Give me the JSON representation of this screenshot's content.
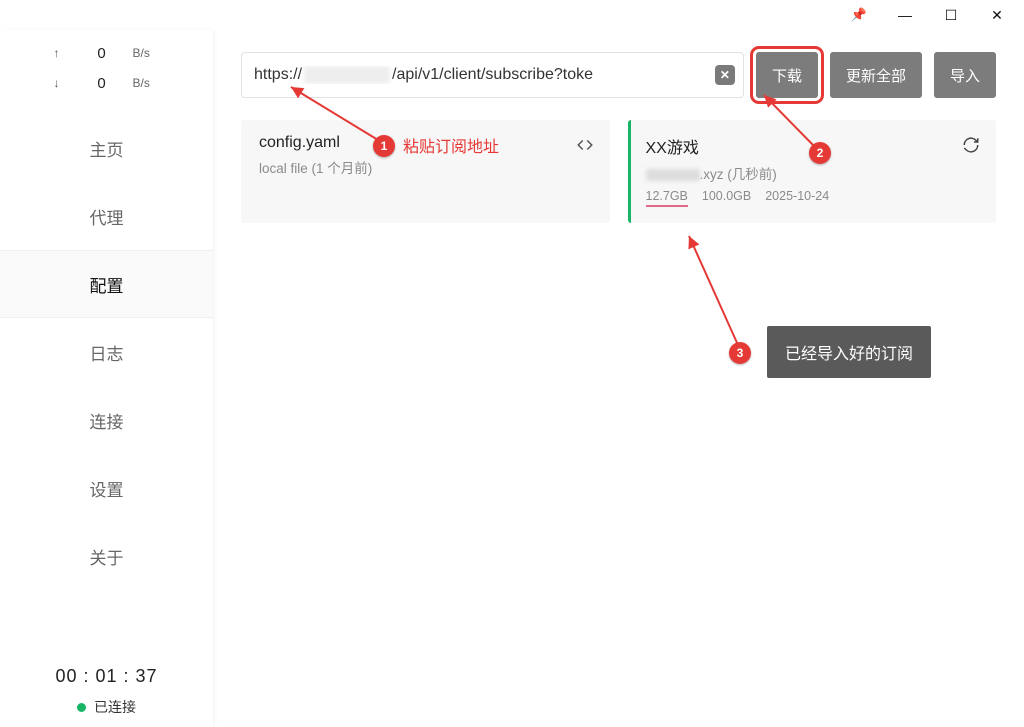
{
  "titlebar": {
    "pin": "📌",
    "min": "—",
    "max": "☐",
    "close": "✕"
  },
  "speeds": {
    "up_arrow": "↑",
    "down_arrow": "↓",
    "up_val": "0",
    "down_val": "0",
    "unit": "B/s"
  },
  "nav": {
    "home": "主页",
    "proxy": "代理",
    "config": "配置",
    "logs": "日志",
    "conn": "连接",
    "settings": "设置",
    "about": "关于"
  },
  "footer": {
    "timer": "00 : 01 : 37",
    "status": "已连接"
  },
  "urlbar": {
    "prefix": "https://",
    "suffix": "/api/v1/client/subscribe?toke",
    "clear": "✕"
  },
  "buttons": {
    "download": "下载",
    "update_all": "更新全部",
    "import": "导入"
  },
  "cards": {
    "local": {
      "title": "config.yaml",
      "sub": "local file (1 个月前)"
    },
    "remote": {
      "title": "XX游戏",
      "sub_suffix": ".xyz (几秒前)",
      "used": "12.7GB",
      "total": "100.0GB",
      "date": "2025-10-24"
    }
  },
  "annotations": {
    "n1": "1",
    "n2": "2",
    "n3": "3",
    "t1": "粘贴订阅地址",
    "t3": "已经导入好的订阅"
  }
}
